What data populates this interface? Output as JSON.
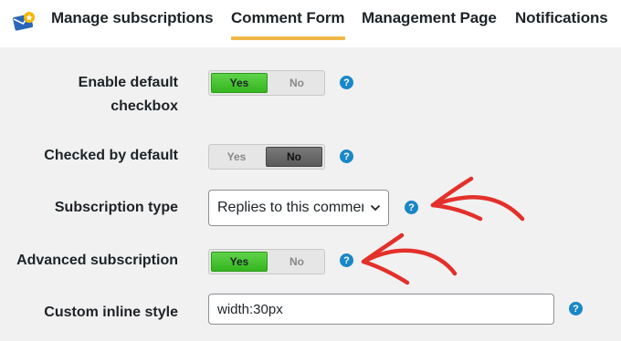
{
  "tabs": [
    {
      "label": "Manage subscriptions",
      "active": false
    },
    {
      "label": "Comment Form",
      "active": true
    },
    {
      "label": "Management Page",
      "active": false
    },
    {
      "label": "Notifications",
      "active": false
    }
  ],
  "icons": {
    "logo": "subscribe-logo-icon",
    "help": "help-circle-icon",
    "chevron": "chevron-down-icon",
    "annotation": "red-arrow-annotation"
  },
  "colors": {
    "accent_tab": "#f0b849",
    "toggle_on": "#3fbf2a",
    "help_blue": "#1a87c8",
    "annotation_red": "#e3302a"
  },
  "toggle_labels": {
    "yes": "Yes",
    "no": "No"
  },
  "help_glyph": "?",
  "rows": {
    "enable_default_checkbox": {
      "label_line1": "Enable default",
      "label_line2": "checkbox",
      "value": "Yes"
    },
    "checked_by_default": {
      "label": "Checked by default",
      "value": "No"
    },
    "subscription_type": {
      "label": "Subscription type",
      "selected": "Replies to this comment"
    },
    "advanced_subscription": {
      "label": "Advanced subscription",
      "value": "Yes"
    },
    "custom_inline_style": {
      "label": "Custom inline style",
      "value": "width:30px"
    }
  }
}
